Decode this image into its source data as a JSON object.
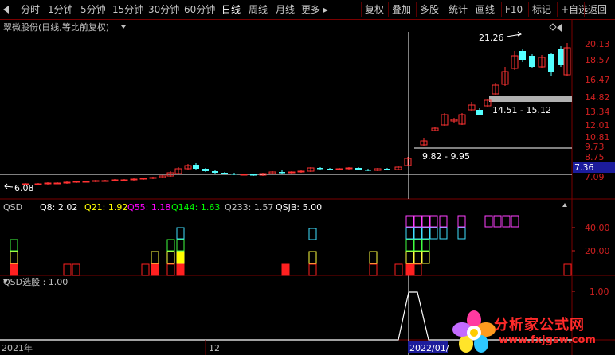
{
  "toolbar": {
    "left_items": [
      "分时",
      "1分钟",
      "5分钟",
      "15分钟",
      "30分钟",
      "60分钟",
      "日线",
      "周线",
      "月线",
      "更多 ▸"
    ],
    "active_item": "日线",
    "right_items": [
      "复权",
      "叠加",
      "多股",
      "统计",
      "画线",
      "F10",
      "标记",
      "+自选",
      "返回"
    ]
  },
  "main_panel": {
    "title": "翠微股份(日线,等比前复权)",
    "price_axis": [
      "20.13",
      "18.57",
      "16.47",
      "14.82",
      "13.34",
      "12.01",
      "10.81",
      "9.73",
      "8.75",
      "7.88",
      "7.09"
    ],
    "current_price_tag": "7.36",
    "annotations": {
      "high": "21.26",
      "low": "6.08",
      "range_upper": "14.51 - 15.12",
      "range_lower": "9.82 - 9.95"
    },
    "colors": {
      "up": "#ff3232",
      "down": "#54ffff",
      "grid": "#7a0000",
      "axis_text": "#d02020"
    }
  },
  "qsd_panel": {
    "name": "QSD",
    "indicators": [
      {
        "label": "Q8:",
        "value": "2.02",
        "color": "#ffffff"
      },
      {
        "label": "Q21:",
        "value": "1.92",
        "color": "#ffff00"
      },
      {
        "label": "Q55:",
        "value": "1.18",
        "color": "#ff00ff"
      },
      {
        "label": "Q144:",
        "value": "1.63",
        "color": "#00ff00"
      },
      {
        "label": "Q233:",
        "value": "1.57",
        "color": "#c0c0c0"
      },
      {
        "label": "QSJB:",
        "value": "5.00",
        "color": "#ffffff"
      }
    ],
    "axis": [
      "40.00",
      "20.00"
    ]
  },
  "select_panel": {
    "label": "QSD选股",
    "value": "1.00",
    "axis": [
      "1.00"
    ]
  },
  "time_axis": {
    "labels": [
      "2021年",
      "12",
      "2022/01/"
    ]
  },
  "logo": {
    "main": "分析家公式网",
    "url": "www.fxjgsw.com"
  }
}
